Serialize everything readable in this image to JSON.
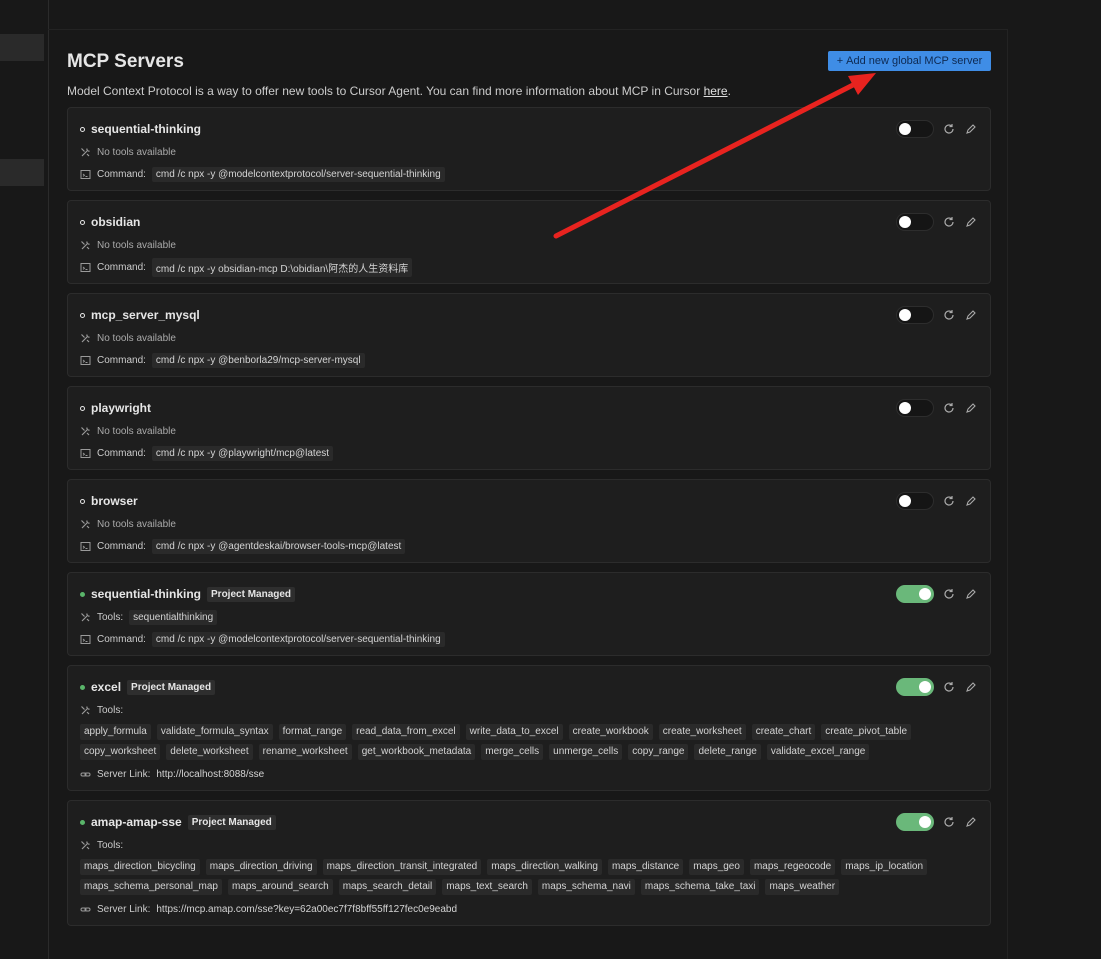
{
  "page": {
    "title": "MCP Servers",
    "description_prefix": "Model Context Protocol is a way to offer new tools to Cursor Agent. You can find more information about MCP in Cursor ",
    "description_link": "here",
    "description_suffix": ".",
    "add_button_label": "Add new global MCP server"
  },
  "labels": {
    "no_tools": "No tools available",
    "command": "Command:",
    "tools": "Tools:",
    "server_link": "Server Link:",
    "project_managed": "Project Managed"
  },
  "servers": [
    {
      "name": "sequential-thinking",
      "enabled": false,
      "command": "cmd /c npx -y @modelcontextprotocol/server-sequential-thinking"
    },
    {
      "name": "obsidian",
      "enabled": false,
      "command": "cmd /c npx -y obsidian-mcp D:\\obidian\\阿杰的人生资料库"
    },
    {
      "name": "mcp_server_mysql",
      "enabled": false,
      "command": "cmd /c npx -y @benborla29/mcp-server-mysql"
    },
    {
      "name": "playwright",
      "enabled": false,
      "command": "cmd /c npx -y @playwright/mcp@latest"
    },
    {
      "name": "browser",
      "enabled": false,
      "command": "cmd /c npx -y @agentdeskai/browser-tools-mcp@latest"
    },
    {
      "name": "sequential-thinking",
      "enabled": true,
      "project_managed": true,
      "tool": "sequentialthinking",
      "command": "cmd /c npx -y @modelcontextprotocol/server-sequential-thinking"
    },
    {
      "name": "excel",
      "enabled": true,
      "project_managed": true,
      "tools": [
        "apply_formula",
        "validate_formula_syntax",
        "format_range",
        "read_data_from_excel",
        "write_data_to_excel",
        "create_workbook",
        "create_worksheet",
        "create_chart",
        "create_pivot_table",
        "copy_worksheet",
        "delete_worksheet",
        "rename_worksheet",
        "get_workbook_metadata",
        "merge_cells",
        "unmerge_cells",
        "copy_range",
        "delete_range",
        "validate_excel_range"
      ],
      "server_link": "http://localhost:8088/sse"
    },
    {
      "name": "amap-amap-sse",
      "enabled": true,
      "project_managed": true,
      "tools": [
        "maps_direction_bicycling",
        "maps_direction_driving",
        "maps_direction_transit_integrated",
        "maps_direction_walking",
        "maps_distance",
        "maps_geo",
        "maps_regeocode",
        "maps_ip_location",
        "maps_schema_personal_map",
        "maps_around_search",
        "maps_search_detail",
        "maps_text_search",
        "maps_schema_navi",
        "maps_schema_take_taxi",
        "maps_weather"
      ],
      "server_link": "https://mcp.amap.com/sse?key=62a00ec7f7f8bff55ff127fec0e9eabd"
    }
  ],
  "colors": {
    "accent": "#3f8de6",
    "toggle_on": "#6ab87a",
    "arrow": "#e8231f"
  }
}
